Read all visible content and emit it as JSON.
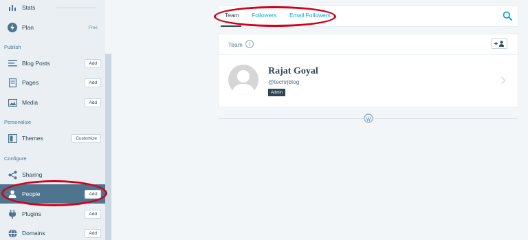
{
  "sidebar": {
    "stats_label": "Stats",
    "plan": {
      "label": "Plan",
      "tag": "Free"
    },
    "sections": {
      "publish": "Publish",
      "personalize": "Personalize",
      "configure": "Configure"
    },
    "items": [
      {
        "label": "Blog Posts",
        "action": "Add",
        "icon": "posts-icon"
      },
      {
        "label": "Pages",
        "action": "Add",
        "icon": "page-icon"
      },
      {
        "label": "Media",
        "action": "Add",
        "icon": "image-icon"
      },
      {
        "label": "Themes",
        "action": "Customize",
        "icon": "themes-icon"
      },
      {
        "label": "Sharing",
        "action": "",
        "icon": "share-icon"
      },
      {
        "label": "People",
        "action": "Add",
        "icon": "person-icon",
        "active": true
      },
      {
        "label": "Plugins",
        "action": "Add",
        "icon": "plug-icon"
      },
      {
        "label": "Domains",
        "action": "Add",
        "icon": "globe-icon"
      }
    ]
  },
  "tabs": [
    {
      "label": "Team",
      "selected": true
    },
    {
      "label": "Followers",
      "selected": false
    },
    {
      "label": "Email Followers",
      "selected": false
    }
  ],
  "team": {
    "title": "Team",
    "count": "1",
    "member": {
      "name": "Rajat Goyal",
      "handle": "@techrjblog",
      "role": "Admin"
    }
  },
  "colors": {
    "accent": "#00aadc",
    "active_bg": "#4f748e",
    "annotation": "#d0021b"
  }
}
